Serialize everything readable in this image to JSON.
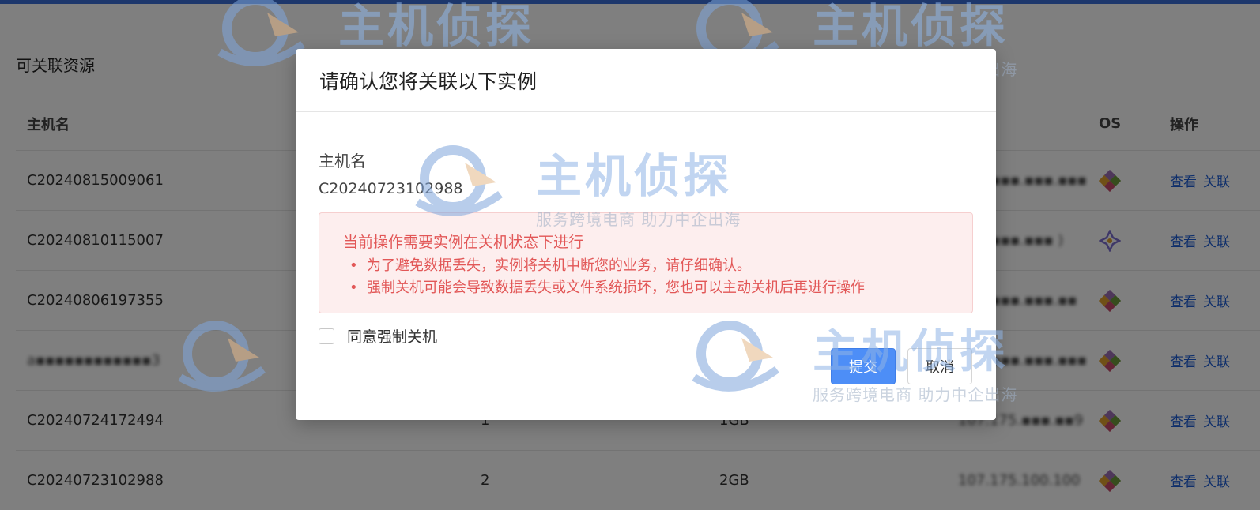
{
  "page": {
    "title": "可关联资源",
    "accent_color": "#3b6fd8"
  },
  "table": {
    "headers": {
      "host": "主机名",
      "os": "OS",
      "ops": "操作"
    },
    "rows": [
      {
        "host": "C20240815009061",
        "cpu": "",
        "mem": "",
        "ip": "1▪▪.▪▪▪.▪▪▪.▪▪▪",
        "view": "查看",
        "link": "关联"
      },
      {
        "host": "C20240810115007",
        "cpu": "",
        "mem": "",
        "ip": "1▪▪.▪▪▪.▪▪▪  )",
        "view": "查看",
        "link": "关联"
      },
      {
        "host": "C20240806197355",
        "cpu": "",
        "mem": "",
        "ip": "1▪▪.▪▪▪.▪▪▪.▪▪",
        "view": "查看",
        "link": "关联"
      },
      {
        "host": "a▪▪▪▪▪▪▪▪▪▪▪▪3",
        "cpu": "",
        "mem": "",
        "ip": "1▪▪.▪▪▪.▪▪▪.▪▪▪",
        "view": "查看",
        "link": "关联"
      },
      {
        "host": "C20240724172494",
        "cpu": "1",
        "mem": "1GB",
        "ip": "107.175.▪▪▪.▪▪9",
        "view": "查看",
        "link": "关联"
      },
      {
        "host": "C20240723102988",
        "cpu": "2",
        "mem": "2GB",
        "ip": "107.175.100.100",
        "view": "查看",
        "link": "关联"
      }
    ]
  },
  "watermark": {
    "brand": "主机侦探",
    "slogan": "服务跨境电商 助力中企出海"
  },
  "modal": {
    "title": "请确认您将关联以下实例",
    "field_label": "主机名",
    "field_value": "C20240723102988",
    "alert": {
      "title": "当前操作需要实例在关机状态下进行",
      "items": [
        "为了避免数据丢失，实例将关机中断您的业务，请仔细确认。",
        "强制关机可能会导致数据丢失或文件系统损坏，您也可以主动关机后再进行操作"
      ],
      "color": "#e25757"
    },
    "checkbox_label": "同意强制关机",
    "submit_label": "提交",
    "cancel_label": "取消",
    "primary_color": "#4d8ef7"
  }
}
